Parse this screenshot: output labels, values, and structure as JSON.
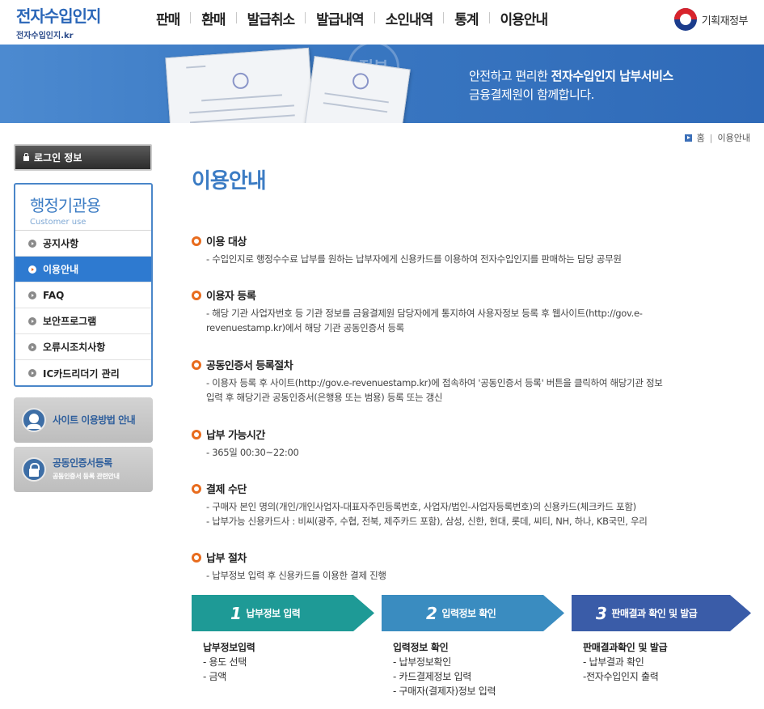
{
  "header": {
    "logo_main": "전자수입인지",
    "logo_sub": "전자수입인지.kr",
    "nav": [
      "판매",
      "환매",
      "발급취소",
      "발급내역",
      "소인내역",
      "통계",
      "이용안내"
    ],
    "gov_name": "기획재정부"
  },
  "banner": {
    "stamp_word": "정부",
    "line1_prefix": "안전하고 편리한 ",
    "line1_bold": "전자수입인지 납부서비스",
    "line2": "금융결제원이 함께합니다."
  },
  "breadcrumb": {
    "home": "홈",
    "current": "이용안내"
  },
  "sidebar": {
    "login_label": "로그인 정보",
    "title": "행정기관용",
    "subtitle": "Customer use",
    "items": [
      {
        "label": "공지사항",
        "active": false
      },
      {
        "label": "이용안내",
        "active": true
      },
      {
        "label": "FAQ",
        "active": false
      },
      {
        "label": "보안프로그램",
        "active": false
      },
      {
        "label": "오류시조치사항",
        "active": false
      },
      {
        "label": "IC카드리더기 관리",
        "active": false
      }
    ],
    "quick_guide": "사이트 이용방법 안내",
    "quick_cert": "공동인증서등록",
    "quick_cert_sub": "공동인증서 등록 관련안내"
  },
  "content": {
    "title": "이용안내",
    "sections": [
      {
        "heading": "이용 대상",
        "lines": [
          "- 수입인지로 행정수수료 납부를 원하는 납부자에게 신용카드를 이용하여 전자수입인지를 판매하는 담당 공무원"
        ]
      },
      {
        "heading": "이용자 등록",
        "lines": [
          "- 해당 기관 사업자번호 등 기관 정보를 금융결제원 담당자에게 통지하여 사용자정보 등록 후 웹사이트(http://gov.e-",
          "revenuestamp.kr)에서 해당 기관 공동인증서 등록"
        ]
      },
      {
        "heading": "공동인증서 등록절차",
        "lines": [
          "- 이용자 등록 후 사이트(http://gov.e-revenuestamp.kr)에 접속하여 '공동인증서 등록' 버튼을 클릭하여 해당기관 정보",
          "입력 후 해당기관 공동인증서(은행용 또는 범용) 등록 또는 갱신"
        ]
      },
      {
        "heading": "납부 가능시간",
        "lines": [
          "- 365일 00:30~22:00"
        ]
      },
      {
        "heading": "결제 수단",
        "lines": [
          "- 구매자 본인 명의(개인/개인사업자-대표자주민등록번호, 사업자/법인-사업자등록번호)의 신용카드(체크카드 포함)",
          "- 납부가능 신용카드사 : 비씨(광주, 수협, 전북, 제주카드 포함), 삼성, 신한, 현대, 롯데, 씨티, NH, 하나, KB국민, 우리"
        ]
      },
      {
        "heading": "납부 절차",
        "lines": [
          "- 납부정보 입력 후 신용카드를 이용한 결제 진행"
        ]
      }
    ],
    "steps": [
      {
        "num": "1",
        "label": "납부정보 입력",
        "color": "#1e9a96",
        "list_title": "납부정보입력",
        "items": [
          "- 용도 선택",
          "- 금액"
        ]
      },
      {
        "num": "2",
        "label": "입력정보 확인",
        "color": "#3a8cc0",
        "list_title": "입력정보 확인",
        "items": [
          "- 납부정보확인",
          "- 카드결제정보 입력",
          "- 구매자(결제자)정보 입력"
        ]
      },
      {
        "num": "3",
        "label": "판매결과 확인 및 발급",
        "color": "#3a5ca8",
        "list_title": "판매결과확인 및 발급",
        "items": [
          "- 납부결과 확인",
          "-전자수입인지 출력"
        ]
      }
    ]
  }
}
